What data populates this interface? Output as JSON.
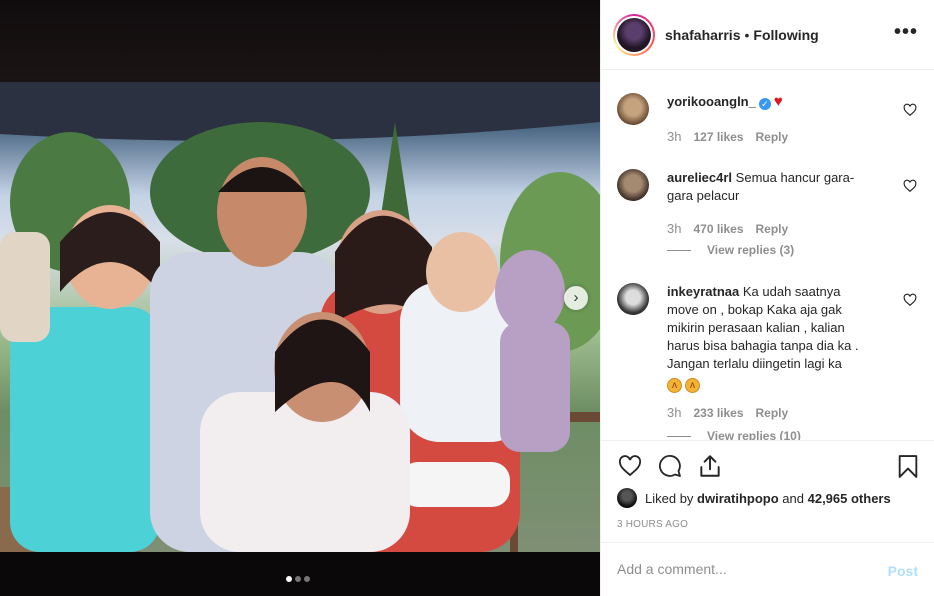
{
  "post": {
    "username": "shafaharris",
    "separator": "•",
    "follow_status": "Following",
    "more_label": "•••"
  },
  "comments": [
    {
      "username": "yorikooangln_",
      "verified": true,
      "text": "",
      "time": "3h",
      "likes": "127 likes",
      "reply": "Reply"
    },
    {
      "username": "aureliec4rl",
      "text": "Semua hancur gara-gara pelacur",
      "time": "3h",
      "likes": "470 likes",
      "reply": "Reply",
      "view_replies": "View replies (3)"
    },
    {
      "username": "inkeyratnaa",
      "text": "Ka udah saatnya move on , bokap Kaka aja gak mikirin perasaan kalian , kalian harus bisa bahagia tanpa dia ka . Jangan terlalu diingetin lagi ka",
      "time": "3h",
      "likes": "233 likes",
      "reply": "Reply",
      "view_replies": "View replies (10)"
    }
  ],
  "likes": {
    "prefix": "Liked by",
    "user": "dwiratihpopo",
    "middle": "and",
    "count": "42,965 others"
  },
  "timestamp": "3 HOURS AGO",
  "comment_box": {
    "placeholder": "Add a comment...",
    "post_label": "Post"
  },
  "carousel": {
    "next_glyph": "›",
    "total_slides": 3,
    "active_slide": 1
  },
  "colors": {
    "link_blue": "#3897f0",
    "post_disabled": "#b2dffc",
    "heart_red": "#e0161e"
  }
}
